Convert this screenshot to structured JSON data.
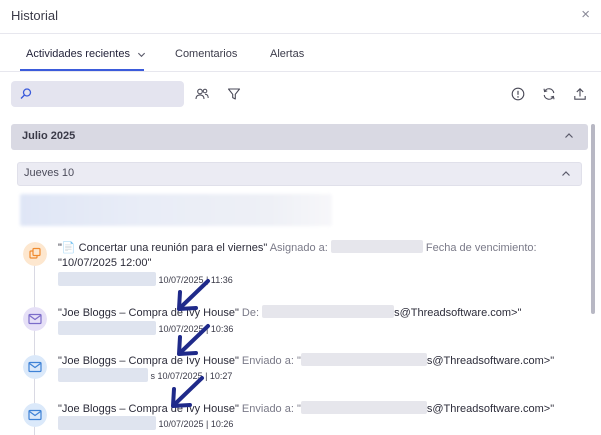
{
  "header": {
    "title": "Historial",
    "close_label": "×"
  },
  "tabs": [
    {
      "label": "Actividades recientes",
      "active": true
    },
    {
      "label": "Comentarios",
      "active": false
    },
    {
      "label": "Alertas",
      "active": false
    }
  ],
  "toolbar": {
    "search_placeholder": "",
    "icons": [
      "search-icon",
      "users-icon",
      "filter-icon",
      "info-icon",
      "refresh-icon",
      "export-icon"
    ]
  },
  "groups": {
    "month": "Julio 2025",
    "day": "Jueves 10"
  },
  "entries": [
    {
      "type": "task",
      "accent": "#f4a04a",
      "title": "\"📄 Concertar una reunión para el viernes\"",
      "label1": "Asignado a:",
      "label2": "Fecha de vencimiento:",
      "line2": "\"10/07/2025 12:00\"",
      "date": "10/07/2025 | 11:36"
    },
    {
      "type": "email-received",
      "accent": "#8b7fd4",
      "title": "\"Joe Bloggs – Compra de Ivy House\"",
      "label1": "De:",
      "tail": "s@Threadsoftware.com>\"",
      "date_prefix": "10/07/2025 | 10:36"
    },
    {
      "type": "email-sent",
      "accent": "#5b9be0",
      "title": "\"Joe Bloggs – Compra de Ivy House\"",
      "label1": "Enviado a: \"",
      "tail": "s@Threadsoftware.com>\"",
      "date_prefix": "s",
      "date": "10/07/2025 | 10:27"
    },
    {
      "type": "email-sent",
      "accent": "#5b9be0",
      "title": "\"Joe Bloggs – Compra de Ivy House\"",
      "label1": "Enviado a: \"",
      "tail": "s@Threadsoftware.com>\"",
      "date": "10/07/2025 | 10:26"
    }
  ],
  "colors": {
    "tab_underline": "#3b5bdb",
    "annotation_arrow": "#1f2a8a",
    "group_bar": "#d9d9e3"
  }
}
